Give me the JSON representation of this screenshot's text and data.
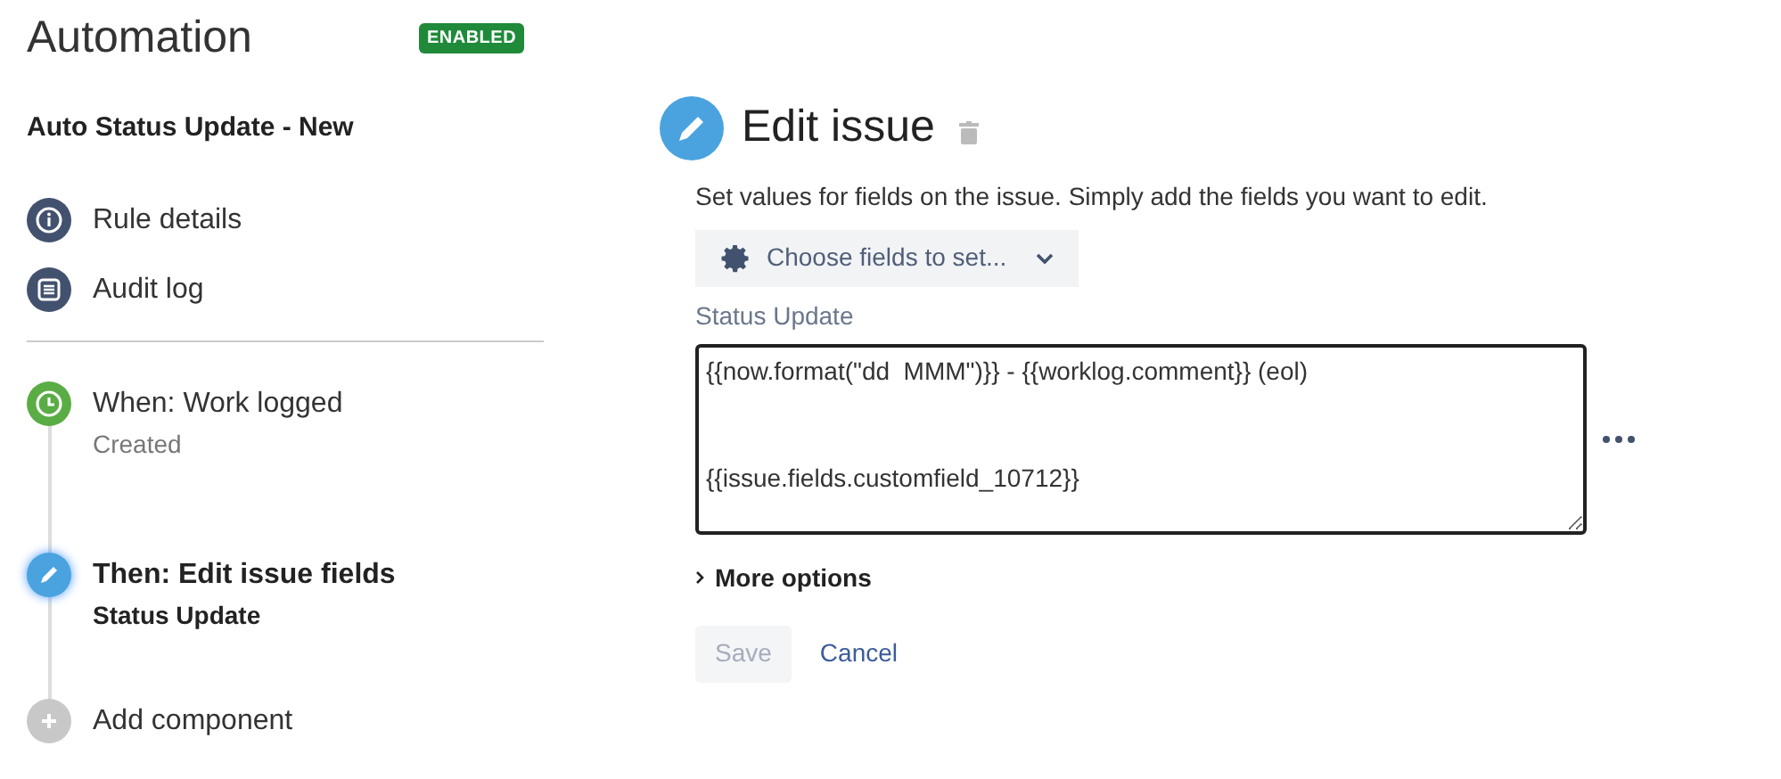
{
  "header": {
    "title": "Automation",
    "status_badge": "ENABLED"
  },
  "rule_name": "Auto Status Update - New",
  "nav_items": [
    {
      "kind": "info",
      "label": "Rule details"
    },
    {
      "kind": "log",
      "label": "Audit log"
    }
  ],
  "steps": [
    {
      "kind": "trigger",
      "title": "When: Work logged",
      "subtitle": "Created",
      "selected": false
    },
    {
      "kind": "action",
      "title": "Then: Edit issue fields",
      "subtitle": "Status Update",
      "selected": true
    },
    {
      "kind": "add",
      "title": "Add component",
      "selected": false
    }
  ],
  "editor": {
    "title": "Edit issue",
    "description": "Set values for fields on the issue. Simply add the fields you want to edit.",
    "choose_button": "Choose fields to set...",
    "field_label": "Status Update",
    "field_value": "{{now.format(\"dd  MMM\")}} - {{worklog.comment}} (eol)\n\n\n{{issue.fields.customfield_10712}}",
    "more_options": "More options",
    "save_button": {
      "label": "Save",
      "disabled": true
    },
    "cancel_link": "Cancel"
  }
}
